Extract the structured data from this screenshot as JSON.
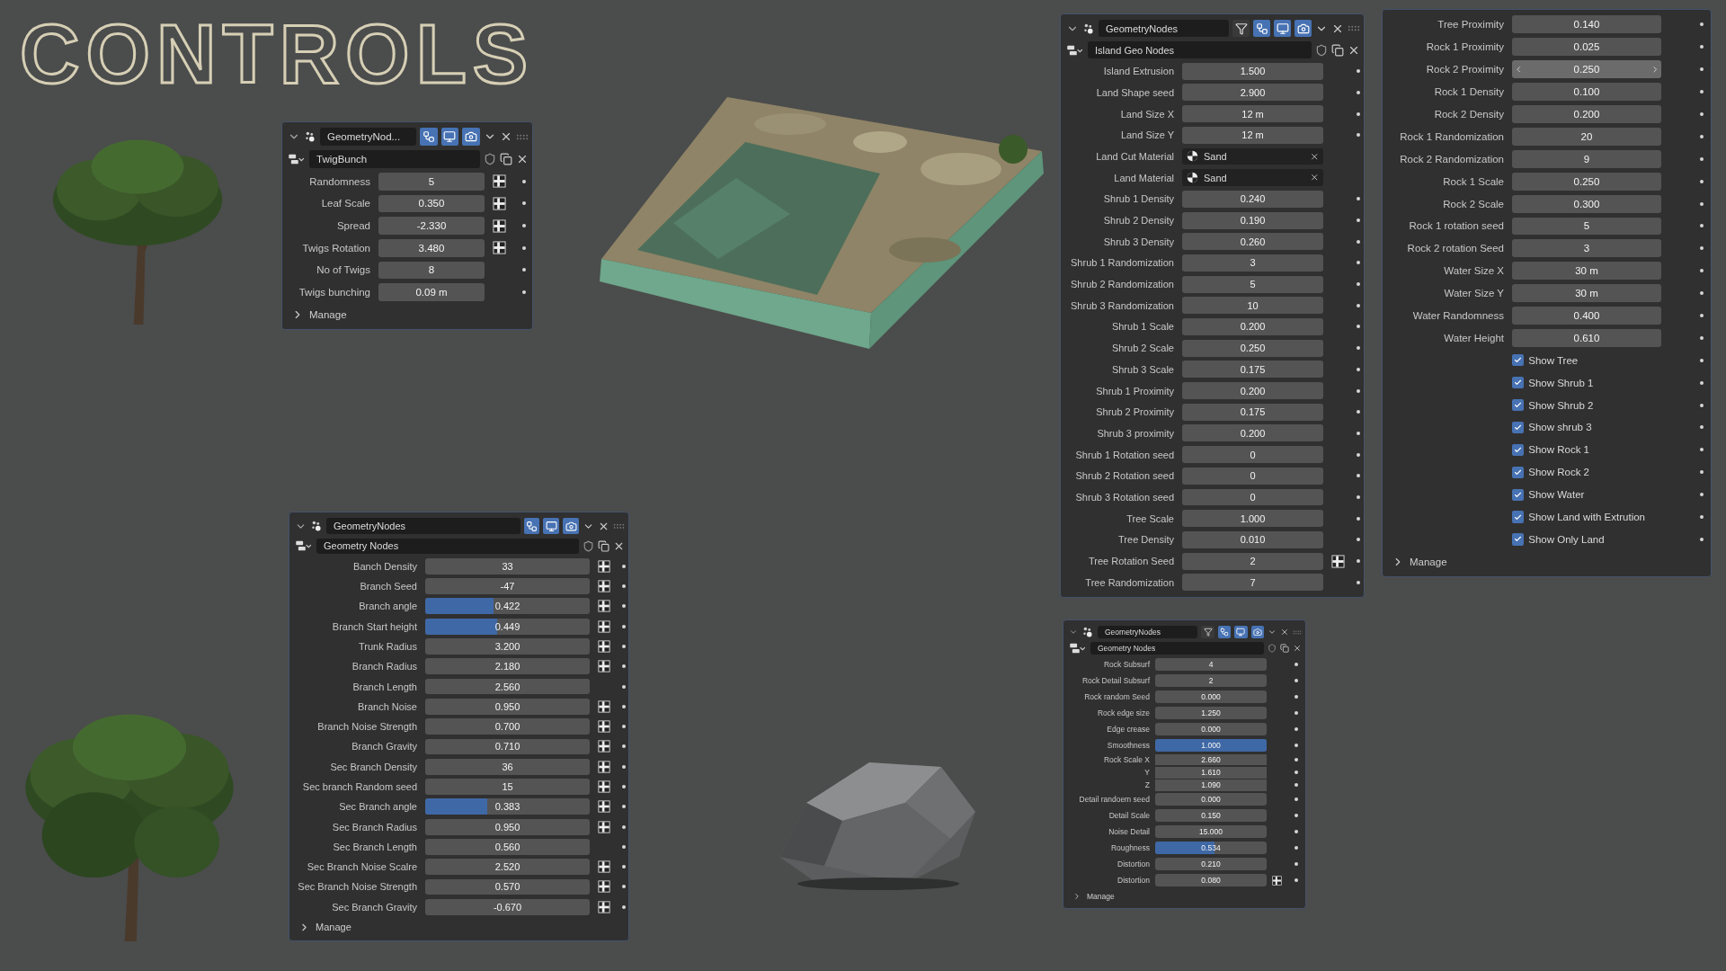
{
  "title": "CONTROLS",
  "panels": [
    {
      "header": {
        "name": "GeometryNod...",
        "toggles": [
          {
            "kind": "nodes",
            "on": true
          },
          {
            "kind": "viewport",
            "on": true
          },
          {
            "kind": "render",
            "on": true
          }
        ]
      },
      "datablock": {
        "name": "TwigBunch"
      },
      "rows": [
        {
          "kind": "number",
          "label": "Randomness",
          "value": "5",
          "attribute_toggle": true
        },
        {
          "kind": "number",
          "label": "Leaf Scale",
          "value": "0.350",
          "attribute_toggle": true
        },
        {
          "kind": "number",
          "label": "Spread",
          "value": "-2.330",
          "attribute_toggle": true
        },
        {
          "kind": "number",
          "label": "Twigs Rotation",
          "value": "3.480",
          "attribute_toggle": true
        },
        {
          "kind": "number",
          "label": "No of Twigs",
          "value": "8",
          "attribute_toggle": false
        },
        {
          "kind": "number",
          "label": "Twigs bunching",
          "value": "0.09 m",
          "attribute_toggle": false
        }
      ],
      "manage": {
        "label": "Manage",
        "expanded": false
      }
    },
    {
      "header": {
        "name": "GeometryNodes",
        "toggles": [
          {
            "kind": "nodes",
            "on": true
          },
          {
            "kind": "viewport",
            "on": true
          },
          {
            "kind": "render",
            "on": true
          }
        ]
      },
      "datablock": {
        "name": "Geometry Nodes"
      },
      "rows": [
        {
          "kind": "number",
          "label": "Banch Density",
          "value": "33",
          "attribute_toggle": true
        },
        {
          "kind": "number",
          "label": "Branch Seed",
          "value": "-47",
          "attribute_toggle": true
        },
        {
          "kind": "number",
          "label": "Branch angle",
          "value": "0.422",
          "level": 0.415,
          "attribute_toggle": true
        },
        {
          "kind": "number",
          "label": "Branch Start height",
          "value": "0.449",
          "level": 0.436,
          "attribute_toggle": true
        },
        {
          "kind": "number",
          "label": "Trunk Radius",
          "value": "3.200",
          "attribute_toggle": true
        },
        {
          "kind": "number",
          "label": "Branch Radius",
          "value": "2.180",
          "attribute_toggle": true
        },
        {
          "kind": "number",
          "label": "Branch Length",
          "value": "2.560",
          "attribute_toggle": false
        },
        {
          "kind": "number",
          "label": "Branch Noise",
          "value": "0.950",
          "attribute_toggle": true
        },
        {
          "kind": "number",
          "label": "Branch Noise Strength",
          "value": "0.700",
          "attribute_toggle": true
        },
        {
          "kind": "number",
          "label": "Branch Gravity",
          "value": "0.710",
          "attribute_toggle": true
        },
        {
          "kind": "number",
          "label": "Sec Branch Density",
          "value": "36",
          "attribute_toggle": true
        },
        {
          "kind": "number",
          "label": "Sec branch Random seed",
          "value": "15",
          "attribute_toggle": true
        },
        {
          "kind": "number",
          "label": "Sec Branch angle",
          "value": "0.383",
          "level": 0.376,
          "attribute_toggle": true
        },
        {
          "kind": "number",
          "label": "Sec Branch Radius",
          "value": "0.950",
          "attribute_toggle": true
        },
        {
          "kind": "number",
          "label": "Sec Branch Length",
          "value": "0.560",
          "attribute_toggle": false
        },
        {
          "kind": "number",
          "label": "Sec Branch Noise Scalre",
          "value": "2.520",
          "attribute_toggle": true
        },
        {
          "kind": "number",
          "label": "Sec Branch Noise Strength",
          "value": "0.570",
          "attribute_toggle": true
        },
        {
          "kind": "number",
          "label": "Sec Branch Gravity",
          "value": "-0.670",
          "attribute_toggle": true
        }
      ],
      "manage": {
        "label": "Manage",
        "expanded": false
      }
    },
    {
      "header": {
        "name": "GeometryNodes",
        "toggles": [
          {
            "kind": "editmode",
            "on": false
          },
          {
            "kind": "nodes",
            "on": true
          },
          {
            "kind": "viewport",
            "on": true
          },
          {
            "kind": "render",
            "on": true
          }
        ]
      },
      "datablock": {
        "name": "Island Geo Nodes"
      },
      "rows": [
        {
          "kind": "number",
          "label": "Island Extrusion",
          "value": "1.500",
          "attribute_toggle": false
        },
        {
          "kind": "number",
          "label": "Land Shape seed",
          "value": "2.900",
          "attribute_toggle": false
        },
        {
          "kind": "number",
          "label": "Land Size X",
          "value": "12 m",
          "attribute_toggle": false
        },
        {
          "kind": "number",
          "label": "Land Size Y",
          "value": "12 m",
          "attribute_toggle": false
        },
        {
          "kind": "material",
          "label": "Land Cut Material",
          "value": "Sand"
        },
        {
          "kind": "material",
          "label": "Land Material",
          "value": "Sand"
        },
        {
          "kind": "number",
          "label": "Shrub 1 Density",
          "value": "0.240",
          "attribute_toggle": false
        },
        {
          "kind": "number",
          "label": "Shrub 2 Density",
          "value": "0.190",
          "attribute_toggle": false
        },
        {
          "kind": "number",
          "label": "Shrub 3 Density",
          "value": "0.260",
          "attribute_toggle": false
        },
        {
          "kind": "number",
          "label": "Shrub 1 Randomization",
          "value": "3",
          "attribute_toggle": false
        },
        {
          "kind": "number",
          "label": "Shrub 2 Randomization",
          "value": "5",
          "attribute_toggle": false
        },
        {
          "kind": "number",
          "label": "Shrub 3 Randomization",
          "value": "10",
          "attribute_toggle": false
        },
        {
          "kind": "number",
          "label": "Shrub 1 Scale",
          "value": "0.200",
          "attribute_toggle": false
        },
        {
          "kind": "number",
          "label": "Shrub 2 Scale",
          "value": "0.250",
          "attribute_toggle": false
        },
        {
          "kind": "number",
          "label": "Shrub 3 Scale",
          "value": "0.175",
          "attribute_toggle": false
        },
        {
          "kind": "number",
          "label": "Shrub 1 Proximity",
          "value": "0.200",
          "attribute_toggle": false
        },
        {
          "kind": "number",
          "label": "Shrub 2 Proximity",
          "value": "0.175",
          "attribute_toggle": false
        },
        {
          "kind": "number",
          "label": "Shrub 3 proximity",
          "value": "0.200",
          "attribute_toggle": false
        },
        {
          "kind": "number",
          "label": "Shrub 1 Rotation seed",
          "value": "0",
          "attribute_toggle": false
        },
        {
          "kind": "number",
          "label": "Shrub 2 Rotation seed",
          "value": "0",
          "attribute_toggle": false
        },
        {
          "kind": "number",
          "label": "Shrub 3 Rotation seed",
          "value": "0",
          "attribute_toggle": false
        },
        {
          "kind": "number",
          "label": "Tree Scale",
          "value": "1.000",
          "attribute_toggle": false
        },
        {
          "kind": "number",
          "label": "Tree Density",
          "value": "0.010",
          "attribute_toggle": false
        },
        {
          "kind": "number",
          "label": "Tree Rotation Seed",
          "value": "2",
          "attribute_toggle": true
        },
        {
          "kind": "number",
          "label": "Tree Randomization",
          "value": "7",
          "attribute_toggle": false
        }
      ]
    },
    {
      "rows": [
        {
          "kind": "number",
          "label": "Tree Proximity",
          "value": "0.140",
          "attribute_toggle": false
        },
        {
          "kind": "number",
          "label": "Rock 1 Proximity",
          "value": "0.025",
          "attribute_toggle": false
        },
        {
          "kind": "hover_number",
          "label": "Rock 2 Proximity",
          "value": "0.250",
          "attribute_toggle": false
        },
        {
          "kind": "number",
          "label": "Rock 1 Density",
          "value": "0.100",
          "attribute_toggle": false
        },
        {
          "kind": "number",
          "label": "Rock 2 Density",
          "value": "0.200",
          "attribute_toggle": false
        },
        {
          "kind": "number",
          "label": "Rock 1 Randomization",
          "value": "20",
          "attribute_toggle": false
        },
        {
          "kind": "number",
          "label": "Rock 2  Randomization",
          "value": "9",
          "attribute_toggle": false
        },
        {
          "kind": "number",
          "label": "Rock 1 Scale",
          "value": "0.250",
          "attribute_toggle": false
        },
        {
          "kind": "number",
          "label": "Rock 2 Scale",
          "value": "0.300",
          "attribute_toggle": false
        },
        {
          "kind": "number",
          "label": "Rock 1 rotation seed",
          "value": "5",
          "attribute_toggle": false
        },
        {
          "kind": "number",
          "label": "Rock 2 rotation Seed",
          "value": "3",
          "attribute_toggle": false
        },
        {
          "kind": "number",
          "label": "Water Size X",
          "value": "30 m",
          "attribute_toggle": false
        },
        {
          "kind": "number",
          "label": "Water Size Y",
          "value": "30 m",
          "attribute_toggle": false
        },
        {
          "kind": "number",
          "label": "Water Randomness",
          "value": "0.400",
          "attribute_toggle": false
        },
        {
          "kind": "number",
          "label": "Water Height",
          "value": "0.610",
          "attribute_toggle": false
        },
        {
          "kind": "checkbox",
          "label": "Show Tree",
          "checked": true
        },
        {
          "kind": "checkbox",
          "label": "Show Shrub 1",
          "checked": true
        },
        {
          "kind": "checkbox",
          "label": "Show Shrub 2",
          "checked": true
        },
        {
          "kind": "checkbox",
          "label": "Show shrub 3",
          "checked": true
        },
        {
          "kind": "checkbox",
          "label": "Show Rock 1",
          "checked": true
        },
        {
          "kind": "checkbox",
          "label": "Show Rock 2",
          "checked": true
        },
        {
          "kind": "checkbox",
          "label": "Show Water",
          "checked": true
        },
        {
          "kind": "checkbox",
          "label": "Show Land with Extrution",
          "checked": true
        },
        {
          "kind": "checkbox",
          "label": "Show Only Land",
          "checked": true
        }
      ],
      "manage": {
        "label": "Manage",
        "expanded": false
      }
    },
    {
      "header": {
        "name": "GeometryNodes",
        "toggles": [
          {
            "kind": "editmode",
            "on": false
          },
          {
            "kind": "nodes",
            "on": true
          },
          {
            "kind": "viewport",
            "on": true
          },
          {
            "kind": "render",
            "on": true
          }
        ]
      },
      "datablock": {
        "name": "Geometry Nodes"
      },
      "rows": [
        {
          "kind": "number",
          "label": "Rock Subsurf",
          "value": "4",
          "attribute_toggle": false
        },
        {
          "kind": "number",
          "label": "Rock Detail Subsurf",
          "value": "2",
          "attribute_toggle": false
        },
        {
          "kind": "number",
          "label": "Rock random Seed",
          "value": "0.000",
          "attribute_toggle": false
        },
        {
          "kind": "number",
          "label": "Rock edge size",
          "value": "1.250",
          "attribute_toggle": false
        },
        {
          "kind": "number",
          "label": "Edge crease",
          "value": "0.000",
          "attribute_toggle": false
        },
        {
          "kind": "number",
          "label": "Smoothness",
          "value": "1.000",
          "level": 1,
          "attribute_toggle": false
        },
        {
          "kind": "vector",
          "label": "Rock Scale X",
          "value": "2.660",
          "attribute_toggle": false
        },
        {
          "kind": "vector",
          "label": "Y",
          "value": "1.610",
          "attribute_toggle": false
        },
        {
          "kind": "vector",
          "label": "Z",
          "value": "1.090",
          "attribute_toggle": false
        },
        {
          "kind": "number",
          "label": "Detail randoem seed",
          "value": "0.000",
          "attribute_toggle": false
        },
        {
          "kind": "number",
          "label": "Detail Scale",
          "value": "0.150",
          "attribute_toggle": false
        },
        {
          "kind": "number",
          "label": "Noise Detail",
          "value": "15.000",
          "attribute_toggle": false
        },
        {
          "kind": "number",
          "label": "Roughness",
          "value": "0.534",
          "level": 0.53,
          "attribute_toggle": false
        },
        {
          "kind": "number",
          "label": "Distortion",
          "value": "0.210",
          "attribute_toggle": false
        },
        {
          "kind": "number",
          "label": "Distortion",
          "value": "0.080",
          "attribute_toggle": true
        }
      ],
      "manage": {
        "label": "Manage",
        "expanded": false
      }
    }
  ]
}
